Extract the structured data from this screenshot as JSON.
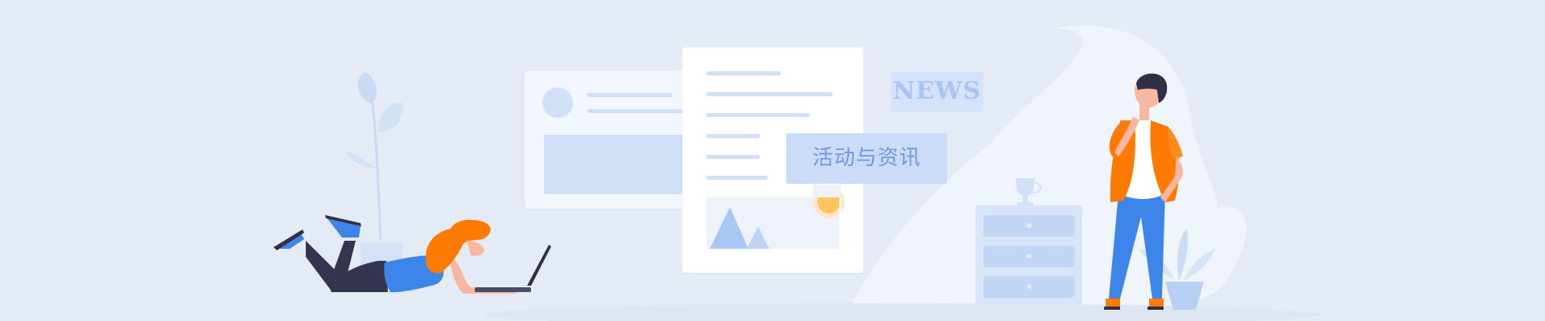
{
  "banner": {
    "title": "活动与资讯",
    "news_label": "NEWS"
  },
  "colors": {
    "background": "#e4ebf4",
    "accent_blue": "#3d85e8",
    "accent_orange": "#ff7a00",
    "light_blue": "#cbdcf8"
  },
  "icons": [
    "plant-icon",
    "woman-laptop-illustration",
    "document-card-illustration",
    "trophy-icon",
    "drawer-cabinet-icon",
    "man-thinking-illustration",
    "sun-icon",
    "mountain-icon"
  ]
}
